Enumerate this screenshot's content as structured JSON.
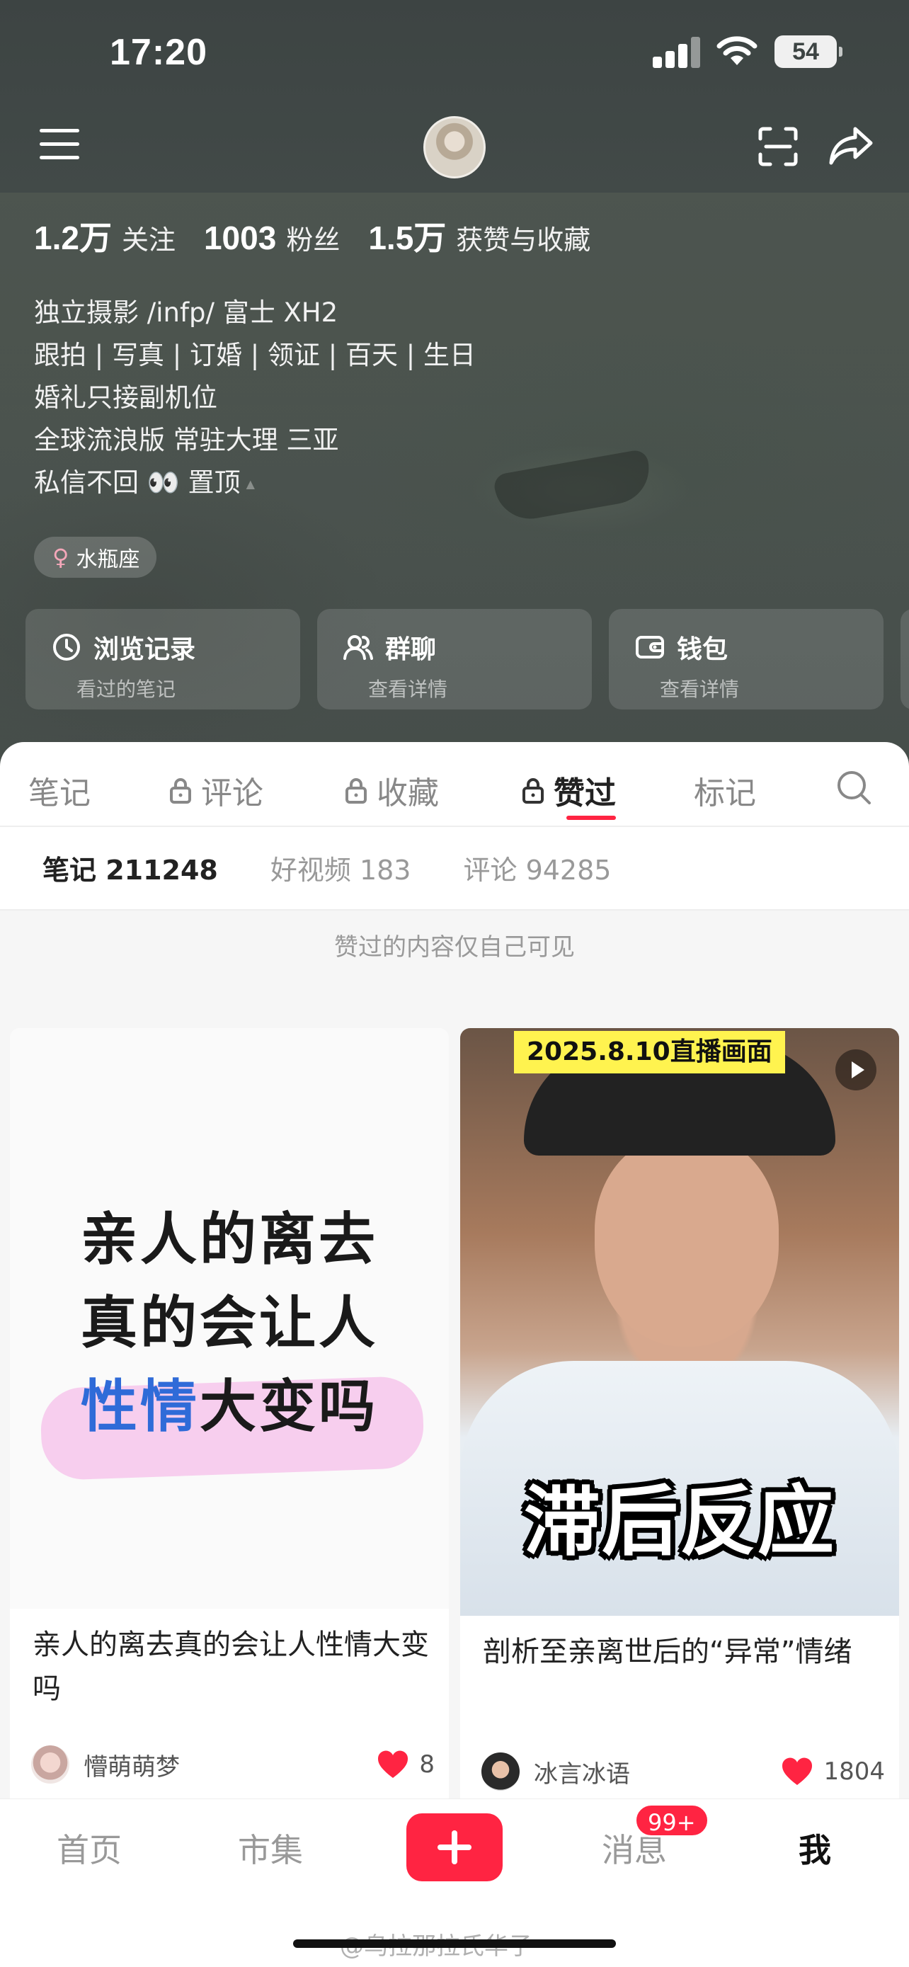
{
  "status_bar": {
    "time": "17:20",
    "battery": "54"
  },
  "profile": {
    "stats": [
      {
        "num": "1.2万",
        "label": "关注"
      },
      {
        "num": "1003",
        "label": "粉丝"
      },
      {
        "num": "1.5万",
        "label": "获赞与收藏"
      }
    ],
    "bio": [
      "独立摄影 /infp/ 富士 XH2",
      "跟拍 | 写真 | 订婚 | 领证 | 百天 | 生日",
      "婚礼只接副机位",
      "全球流浪版 常驻大理 三亚",
      "私信不回 👀 置顶"
    ],
    "zodiac": "水瓶座",
    "cards": [
      {
        "title": "浏览记录",
        "sub": "看过的笔记",
        "icon": "clock-icon"
      },
      {
        "title": "群聊",
        "sub": "查看详情",
        "icon": "group-icon"
      },
      {
        "title": "钱包",
        "sub": "查看详情",
        "icon": "wallet-icon"
      }
    ]
  },
  "tabs": {
    "items": [
      "笔记",
      "评论",
      "收藏",
      "赞过",
      "标记"
    ],
    "active": "赞过"
  },
  "subtabs": [
    "笔记 211248",
    "好视频 183",
    "评论 94285"
  ],
  "notice": "赞过的内容仅自己可见",
  "notes": [
    {
      "cover_lines": [
        "亲人的离去",
        "真的会让人",
        "性情大变吗"
      ],
      "cover_blue": "性情",
      "cover_rest": "大变吗",
      "title": "亲人的离去真的会让人性情大变吗",
      "author": "懵萌萌梦",
      "likes": "8"
    },
    {
      "cover_tag": "2025.8.10直播画面",
      "cover_big": "滞后反应",
      "title": "剖析至亲离世后的“异常”情绪",
      "author": "冰言冰语",
      "likes": "1804"
    }
  ],
  "bottom_nav": {
    "items": [
      "首页",
      "市集",
      "消息",
      "我"
    ],
    "badge": "99+",
    "active": "我",
    "watermark": "@乌拉那拉氏华子"
  },
  "colors": {
    "accent": "#ff2442",
    "header_bg": "#3d4443"
  }
}
